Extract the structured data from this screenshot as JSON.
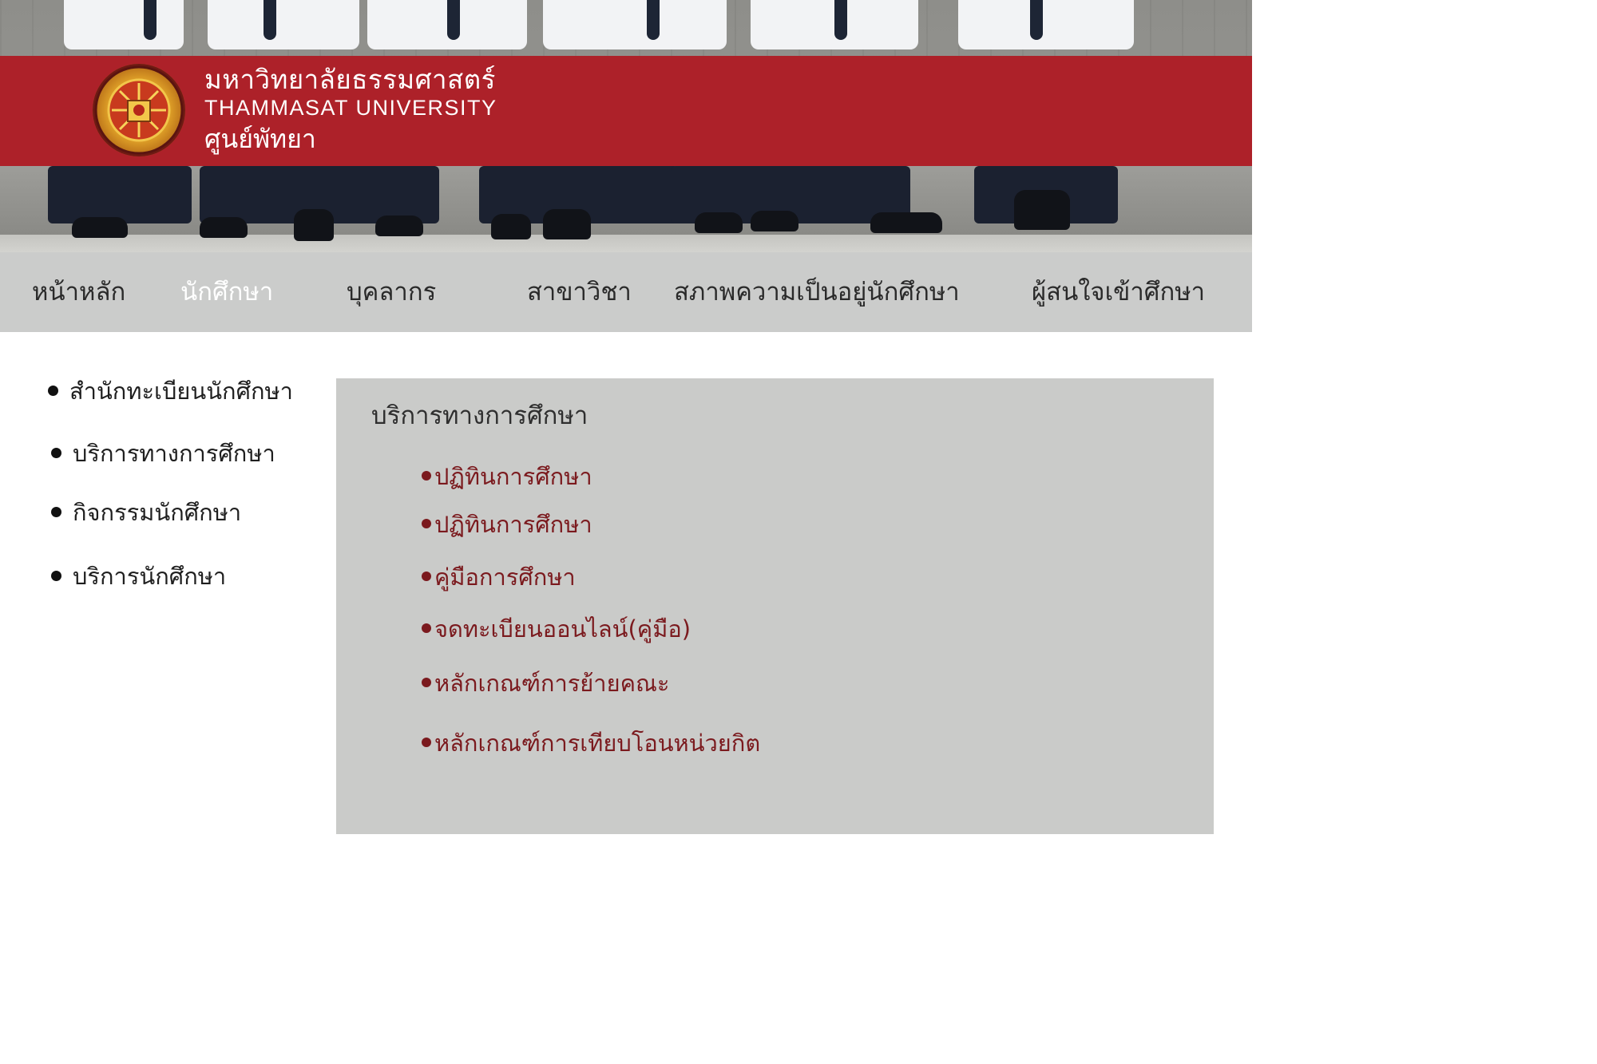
{
  "banner": {
    "title_th": "มหาวิทยาลัยธรรมศาสตร์",
    "title_en": "THAMMASAT UNIVERSITY",
    "campus": "ศูนย์พัทยา",
    "background_color": "#ad2129"
  },
  "nav": {
    "items": [
      {
        "label": "หน้าหลัก",
        "active": false
      },
      {
        "label": "นักศึกษา",
        "active": true
      },
      {
        "label": "บุคลากร",
        "active": false
      },
      {
        "label": "สาขาวิชา",
        "active": false
      },
      {
        "label": "สภาพความเป็นอยู่นักศึกษา",
        "active": false
      },
      {
        "label": "ผู้สนใจเข้าศึกษา",
        "active": false
      }
    ]
  },
  "sidebar": {
    "items": [
      {
        "label": "สำนักทะเบียนนักศึกษา"
      },
      {
        "label": "บริการทางการศึกษา"
      },
      {
        "label": "กิจกรรมนักศึกษา"
      },
      {
        "label": "บริการนักศึกษา"
      }
    ]
  },
  "panel": {
    "title": "บริการทางการศึกษา",
    "links": [
      {
        "label": "ปฏิทินการศึกษา"
      },
      {
        "label": "ปฏิทินการศึกษา"
      },
      {
        "label": "คู่มือการศึกษา"
      },
      {
        "label": "จดทะเบียนออนไลน์(คู่มือ)"
      },
      {
        "label": "หลักเกณฑ์การย้ายคณะ"
      },
      {
        "label": "หลักเกณฑ์การเทียบโอนหน่วยกิต"
      }
    ],
    "link_color": "#7b1a1e",
    "background_color": "#cacbc9"
  }
}
